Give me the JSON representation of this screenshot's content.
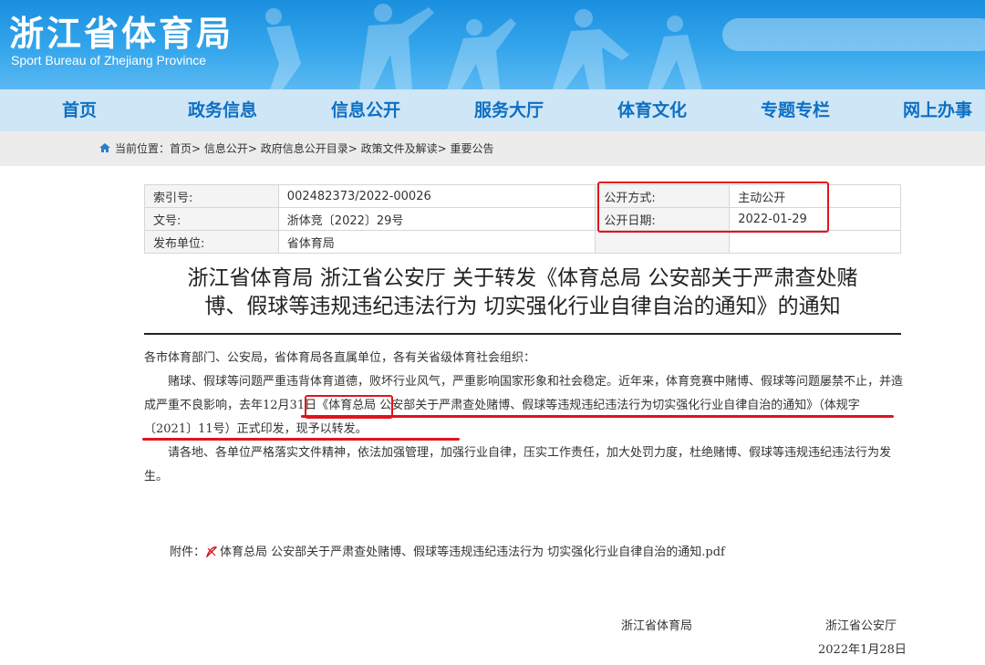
{
  "header": {
    "title_cn": "浙江省体育局",
    "title_en": "Sport Bureau of Zhejiang Province"
  },
  "nav": [
    "首页",
    "政务信息",
    "信息公开",
    "服务大厅",
    "体育文化",
    "专题专栏",
    "网上办事"
  ],
  "breadcrumb": {
    "label": "当前位置：",
    "path": "首页> 信息公开> 政府信息公开目录> 政策文件及解读> 重要公告"
  },
  "meta": {
    "index_label": "索引号:",
    "index_value": "002482373/2022-00026",
    "method_label": "公开方式:",
    "method_value": "主动公开",
    "docno_label": "文号:",
    "docno_value": "浙体竞〔2022〕29号",
    "date_label": "公开日期:",
    "date_value": "2022-01-29",
    "issuer_label": "发布单位:",
    "issuer_value": "省体育局"
  },
  "document": {
    "title_line1": "浙江省体育局 浙江省公安厅 关于转发《体育总局 公安部关于严肃查处赌",
    "title_line2": "博、假球等违规违纪违法行为 切实强化行业自律自治的通知》的通知",
    "salutation": "各市体育部门、公安局，省体育局各直属单位，各有关省级体育社会组织：",
    "para1": "赌球、假球等问题严重违背体育道德，败坏行业风气，严重影响国家形象和社会稳定。近年来，体育竞赛中赌博、假球等问题屡禁不止，并造成严重不良影响，去年12月31日《体育总局 公安部关于严肃查处赌博、假球等违规违纪违法行为切实强化行业自律自治的通知》（体规字〔2021〕11号）正式印发，现予以转发。",
    "para2": "请各地、各单位严格落实文件精神，依法加强管理，加强行业自律，压实工作责任，加大处罚力度，杜绝赌博、假球等违规违纪违法行为发生。",
    "attachment_label": "附件：",
    "attachment_name": "体育总局 公安部关于严肃查处赌博、假球等违规违纪违法行为 切实强化行业自律自治的通知.pdf",
    "signer1": "浙江省体育局",
    "signer2": "浙江省公安厅",
    "sign_date": "2022年1月28日"
  },
  "colors": {
    "banner": "#1a8fde",
    "nav_text": "#0d6fc2",
    "highlight": "#e0141e"
  }
}
